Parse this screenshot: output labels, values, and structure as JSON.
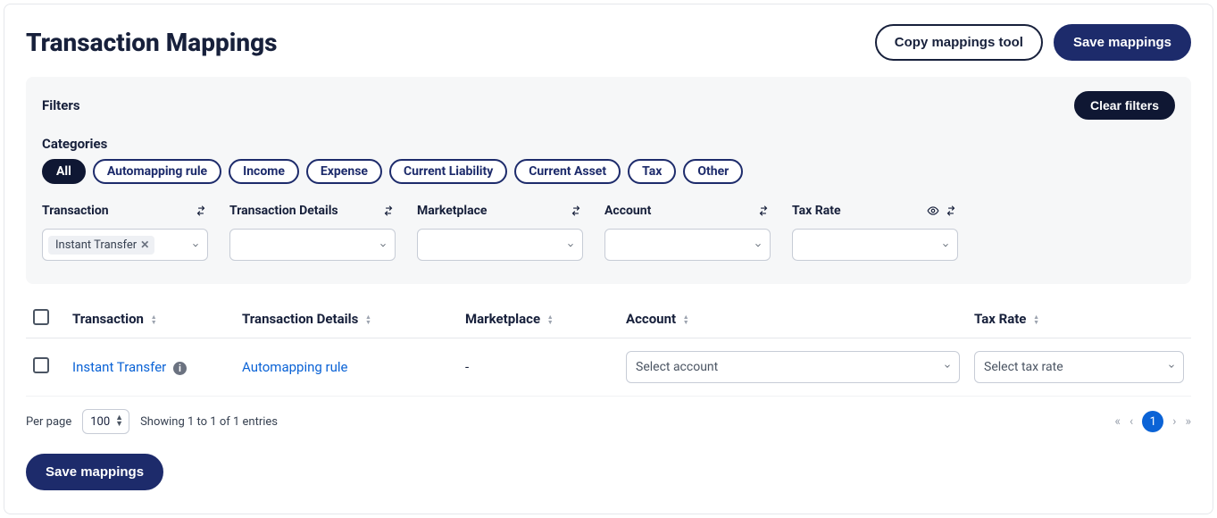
{
  "header": {
    "title": "Transaction Mappings",
    "copy_tool": "Copy mappings tool",
    "save": "Save mappings"
  },
  "filters_panel": {
    "label": "Filters",
    "clear_btn": "Clear filters",
    "categories_label": "Categories",
    "chips": [
      "All",
      "Automapping rule",
      "Income",
      "Expense",
      "Current Liability",
      "Current Asset",
      "Tax",
      "Other"
    ],
    "active_chip_index": 0,
    "columns": {
      "transaction": {
        "label": "Transaction",
        "selected_tags": [
          "Instant Transfer"
        ]
      },
      "transaction_details": {
        "label": "Transaction Details"
      },
      "marketplace": {
        "label": "Marketplace"
      },
      "account": {
        "label": "Account"
      },
      "tax_rate": {
        "label": "Tax Rate"
      }
    }
  },
  "table": {
    "headers": {
      "transaction": "Transaction",
      "transaction_details": "Transaction Details",
      "marketplace": "Marketplace",
      "account": "Account",
      "tax_rate": "Tax Rate"
    },
    "rows": [
      {
        "transaction": "Instant Transfer",
        "transaction_details": "Automapping rule",
        "marketplace": "-",
        "account_placeholder": "Select account",
        "tax_rate_placeholder": "Select tax rate"
      }
    ]
  },
  "footer": {
    "per_page_label": "Per page",
    "per_page_value": "100",
    "showing": "Showing 1 to 1 of 1 entries",
    "current_page": "1",
    "save": "Save mappings"
  }
}
